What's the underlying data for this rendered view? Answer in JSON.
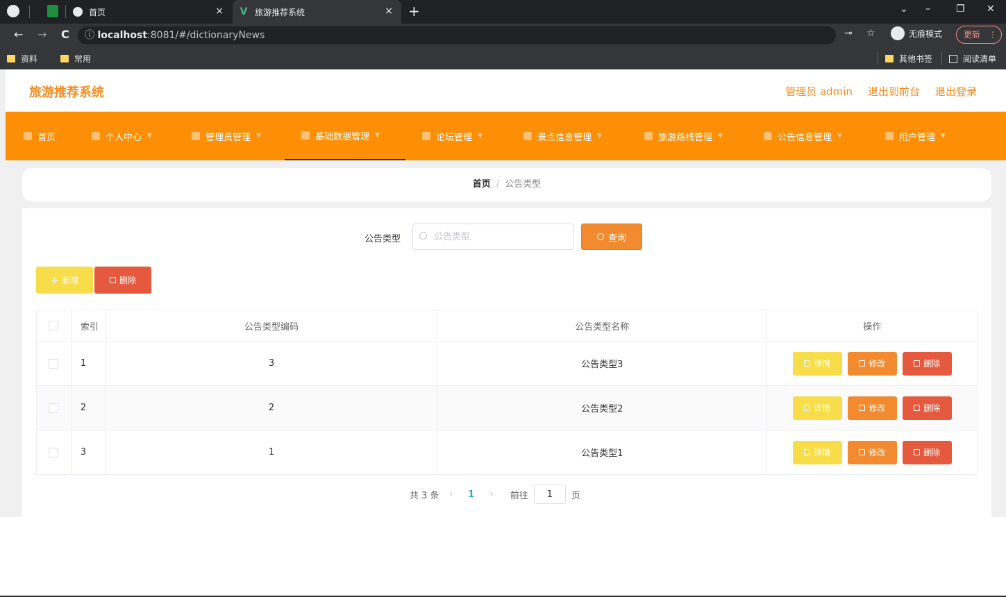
{
  "browser": {
    "tabs": [
      {
        "title": "首页",
        "close": "×"
      },
      {
        "title": "旅游推荐系统",
        "close": "×"
      }
    ],
    "new_tab": "+",
    "url_host": "localhost",
    "url_rest": ":8081/#/dictionaryNews",
    "incognito_label": "无痕模式",
    "update_label": "更新",
    "bookmarks": [
      "资料",
      "常用"
    ],
    "bookmarks_right": [
      "其他书签",
      "阅读清单"
    ],
    "nav": {
      "back": "←",
      "forward": "→",
      "reload": "C",
      "info": "ⓘ"
    },
    "window": {
      "minimize": "–",
      "restore": "❐",
      "close": "✕",
      "chevron": "⌄"
    }
  },
  "app": {
    "title": "旅游推荐系统",
    "header_links": [
      "管理员 admin",
      "退出到前台",
      "退出登录"
    ]
  },
  "menu": [
    {
      "label": "首页",
      "active": false
    },
    {
      "label": "个人中心",
      "active": false
    },
    {
      "label": "管理员管理",
      "active": false
    },
    {
      "label": "基础数据管理",
      "active": true
    },
    {
      "label": "论坛管理",
      "active": false
    },
    {
      "label": "景点信息管理",
      "active": false
    },
    {
      "label": "旅游路线管理",
      "active": false
    },
    {
      "label": "公告信息管理",
      "active": false
    },
    {
      "label": "用户管理",
      "active": false
    }
  ],
  "breadcrumb": {
    "home": "首页",
    "separator": "/",
    "current": "公告类型"
  },
  "search": {
    "label": "公告类型",
    "placeholder": "公告类型",
    "button": "查询"
  },
  "actions": {
    "add": "新增",
    "delete": "删除"
  },
  "table": {
    "headers": {
      "index": "索引",
      "code": "公告类型编码",
      "name": "公告类型名称",
      "ops": "操作"
    },
    "rows": [
      {
        "index": "1",
        "code": "3",
        "name": "公告类型3"
      },
      {
        "index": "2",
        "code": "2",
        "name": "公告类型2"
      },
      {
        "index": "3",
        "code": "1",
        "name": "公告类型1"
      }
    ],
    "op_labels": {
      "detail": "详情",
      "edit": "修改",
      "delete": "删除"
    }
  },
  "pagination": {
    "total": "共 3 条",
    "prev": "‹",
    "current": "1",
    "next": "›",
    "goto": "前往",
    "goto_value": "1",
    "page_unit": "页"
  },
  "colors": {
    "brand": "#fd8f07",
    "title": "#f58b1f",
    "detail": "#f7dd4a",
    "edit": "#f28b30",
    "delete": "#e55a3e"
  }
}
